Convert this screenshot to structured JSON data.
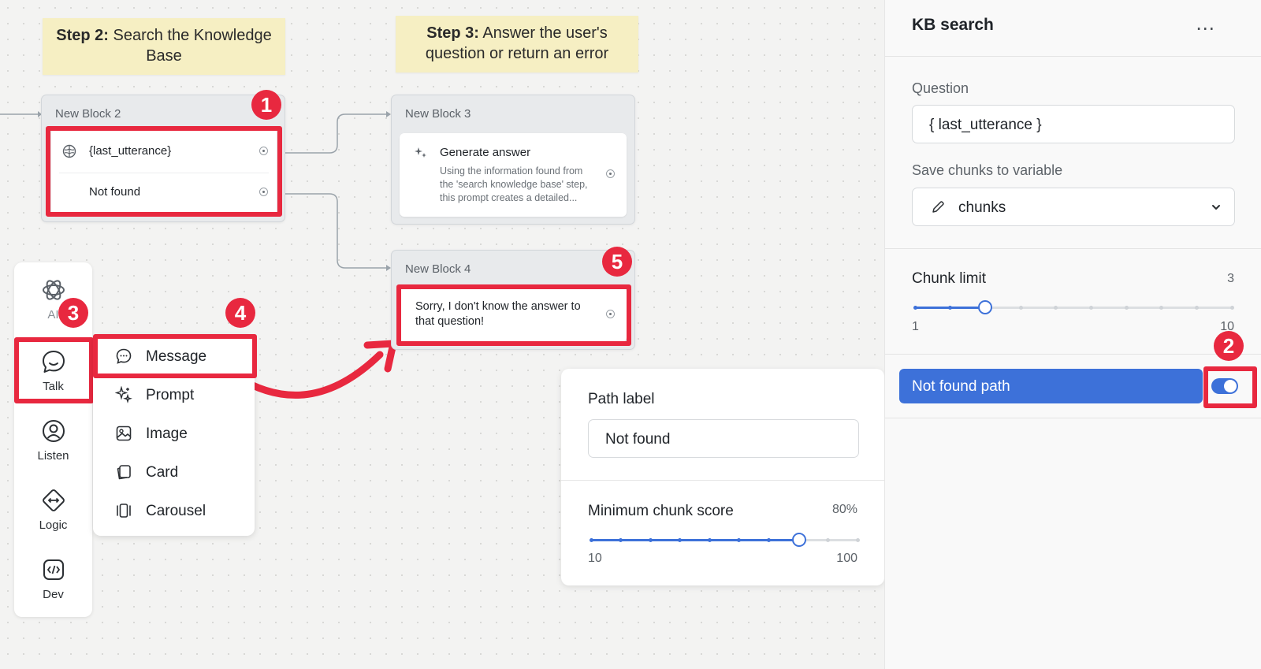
{
  "notes": {
    "step2_bold": "Step 2:",
    "step2_text": " Search the Knowledge Base",
    "step3_bold": "Step 3:",
    "step3_text": " Answer the user's question or return an error"
  },
  "blocks": {
    "block2": {
      "title": "New Block 2",
      "row1": "{last_utterance}",
      "row2": "Not found"
    },
    "block3": {
      "title": "New Block 3",
      "step_title": "Generate answer",
      "step_desc_1": "Using the information found from",
      "step_desc_2": "the 'search knowledge base' step,",
      "step_desc_3": "this prompt creates a detailed..."
    },
    "block4": {
      "title": "New Block 4",
      "message_1": "Sorry, I don't know the answer to",
      "message_2": "that question!"
    }
  },
  "badges": [
    "1",
    "2",
    "3",
    "4",
    "5"
  ],
  "toolbar": {
    "items": [
      {
        "label": "AI",
        "icon": "openai-icon"
      },
      {
        "label": "Talk",
        "icon": "chat-bubble-icon"
      },
      {
        "label": "Listen",
        "icon": "user-circle-icon"
      },
      {
        "label": "Logic",
        "icon": "diamond-arrows-icon"
      },
      {
        "label": "Dev",
        "icon": "code-icon"
      }
    ]
  },
  "menu": {
    "items": [
      {
        "label": "Message",
        "icon": "message-icon"
      },
      {
        "label": "Prompt",
        "icon": "sparkle-icon"
      },
      {
        "label": "Image",
        "icon": "image-icon"
      },
      {
        "label": "Card",
        "icon": "card-icon"
      },
      {
        "label": "Carousel",
        "icon": "carousel-icon"
      }
    ]
  },
  "path_panel": {
    "path_label": "Path label",
    "path_value": "Not found",
    "min_score_label": "Minimum chunk score",
    "min_score_value": "80%",
    "min": "10",
    "max": "100",
    "level": 0.78
  },
  "sidebar": {
    "title": "KB search",
    "question_label": "Question",
    "question_value": "{ last_utterance }",
    "save_label": "Save chunks to variable",
    "save_value": "chunks",
    "chunk_limit_label": "Chunk limit",
    "chunk_limit_value": "3",
    "chunk_min": "1",
    "chunk_max": "10",
    "chunk_level": 0.222,
    "not_found_label": "Not found path",
    "toggle_on": true
  },
  "colors": {
    "accent": "#3d71d9",
    "annotation": "#e8283f",
    "note": "#f6efc3"
  }
}
